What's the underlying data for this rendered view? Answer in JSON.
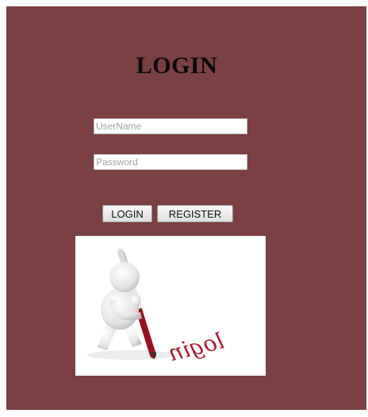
{
  "page": {
    "title": "LOGIN",
    "background_color": "#7a4042"
  },
  "form": {
    "username_placeholder": "UserName",
    "username_value": "",
    "password_placeholder": "Password",
    "password_value": "",
    "login_label": "LOGIN",
    "register_label": "REGISTER"
  },
  "illustration": {
    "subject": "3d-figure-writing-with-pen",
    "handwritten_word": "login",
    "ink_color": "#b0182a"
  }
}
